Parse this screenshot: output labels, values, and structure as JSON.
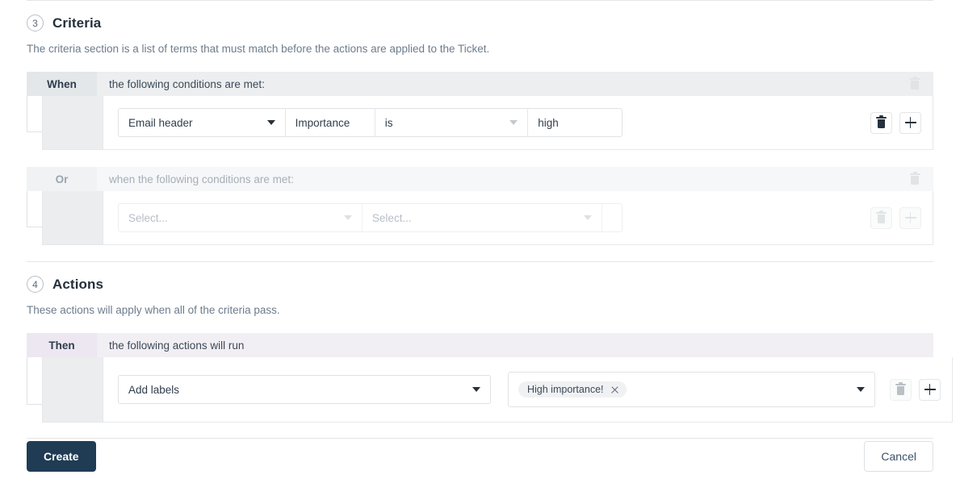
{
  "colors": {
    "primary_button_bg": "#1f3c54",
    "when_bar_bg": "#eceef0",
    "or_bar_bg": "#f6f7f8",
    "then_bar_bg": "#f2eff4",
    "gutter_bg": "#ebedef",
    "muted_text": "#6d7c8b",
    "icon_dark": "#25313d"
  },
  "criteria": {
    "step_number": "3",
    "title": "Criteria",
    "description": "The criteria section is a list of terms that must match before the actions are applied to the Ticket.",
    "when_bar": {
      "keyword": "When",
      "text": "the following conditions are met:",
      "trash_icon": "trash-icon",
      "trash_enabled": false
    },
    "when_row": {
      "field": "Email header",
      "field_caret": "chevron-down-icon",
      "name": "Importance",
      "operator": "is",
      "operator_caret": "chevron-down-icon",
      "value": "high",
      "delete_icon": "trash-icon",
      "add_icon": "plus-icon",
      "enabled": true
    },
    "or_bar": {
      "keyword": "Or",
      "text": "when the following conditions are met:",
      "trash_icon": "trash-icon",
      "trash_enabled": false
    },
    "or_row": {
      "field_placeholder": "Select...",
      "field_caret": "chevron-down-icon",
      "operator_placeholder": "Select...",
      "operator_caret": "chevron-down-icon",
      "value": "",
      "delete_icon": "trash-icon",
      "add_icon": "plus-icon",
      "enabled": false
    }
  },
  "actions": {
    "step_number": "4",
    "title": "Actions",
    "description": "These actions will apply when all of the criteria pass.",
    "then_bar": {
      "keyword": "Then",
      "text": "the following actions will run"
    },
    "then_row": {
      "action": "Add labels",
      "action_caret": "chevron-down-icon",
      "labels": [
        {
          "text": "High importance!",
          "remove_icon": "close-icon"
        }
      ],
      "labels_caret": "chevron-down-icon",
      "delete_icon": "trash-icon",
      "delete_enabled": false,
      "add_icon": "plus-icon",
      "add_enabled": true
    }
  },
  "footer": {
    "create_label": "Create",
    "cancel_label": "Cancel"
  }
}
